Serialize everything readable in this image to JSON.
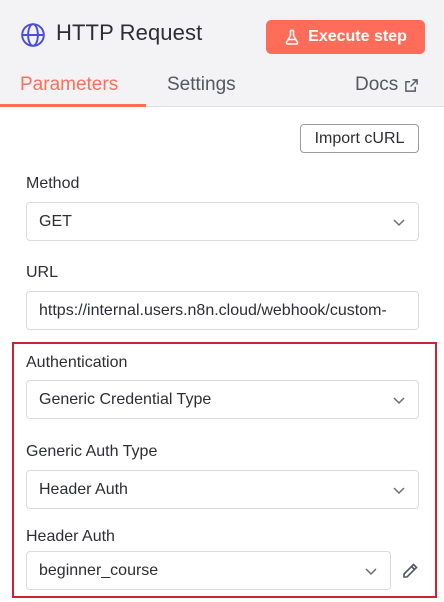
{
  "header": {
    "title": "HTTP Request",
    "execute_label": "Execute step",
    "accent": "#ff6d5a"
  },
  "tabs": [
    {
      "label": "Parameters",
      "active": true
    },
    {
      "label": "Settings",
      "active": false
    }
  ],
  "docs_label": "Docs",
  "import_label": "Import cURL",
  "fields": {
    "method": {
      "label": "Method",
      "value": "GET"
    },
    "url": {
      "label": "URL",
      "value": "https://internal.users.n8n.cloud/webhook/custom-"
    },
    "authentication": {
      "label": "Authentication",
      "value": "Generic Credential Type"
    },
    "generic_auth_type": {
      "label": "Generic Auth Type",
      "value": "Header Auth"
    },
    "header_auth": {
      "label": "Header Auth",
      "value": "beginner_course"
    }
  },
  "highlight_color": "#cc2233"
}
